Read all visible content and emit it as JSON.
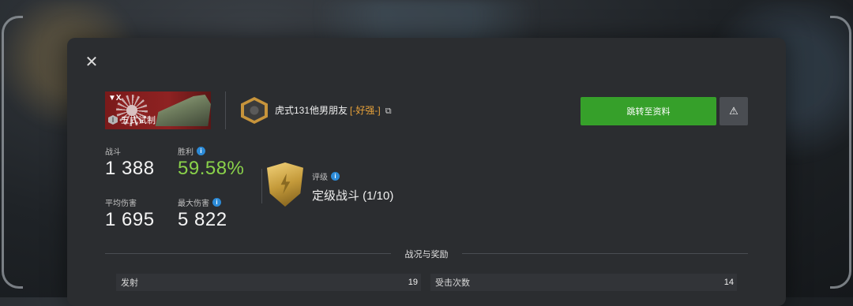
{
  "modal": {
    "close_icon": "✕",
    "tank": {
      "tier": "▼X",
      "name": "五式试制",
      "level": "I"
    },
    "player": {
      "name": "虎式131他男朋友",
      "clan": "[-好强-]",
      "copy_icon": "⧉"
    },
    "actions": {
      "goto_profile": "跳转至资料",
      "report_icon": "⚠"
    },
    "stats": {
      "battles": {
        "label": "战斗",
        "value": "1 388"
      },
      "winrate": {
        "label": "胜利",
        "value": "59.58%"
      },
      "avg_damage": {
        "label": "平均伤害",
        "value": "1 695"
      },
      "max_damage": {
        "label": "最大伤害",
        "value": "5 822"
      }
    },
    "rank": {
      "label": "评级",
      "value": "定级战斗 (1/10)"
    },
    "section": {
      "title": "战况与奖励"
    },
    "rows": [
      {
        "label": "发射",
        "value": "19"
      },
      {
        "label": "受击次数",
        "value": "14"
      }
    ],
    "colors": {
      "accent_green": "#36a02a",
      "winrate_green": "#8ad24a",
      "clan_orange": "#e8a23a",
      "info_blue": "#2c8bd8"
    }
  }
}
